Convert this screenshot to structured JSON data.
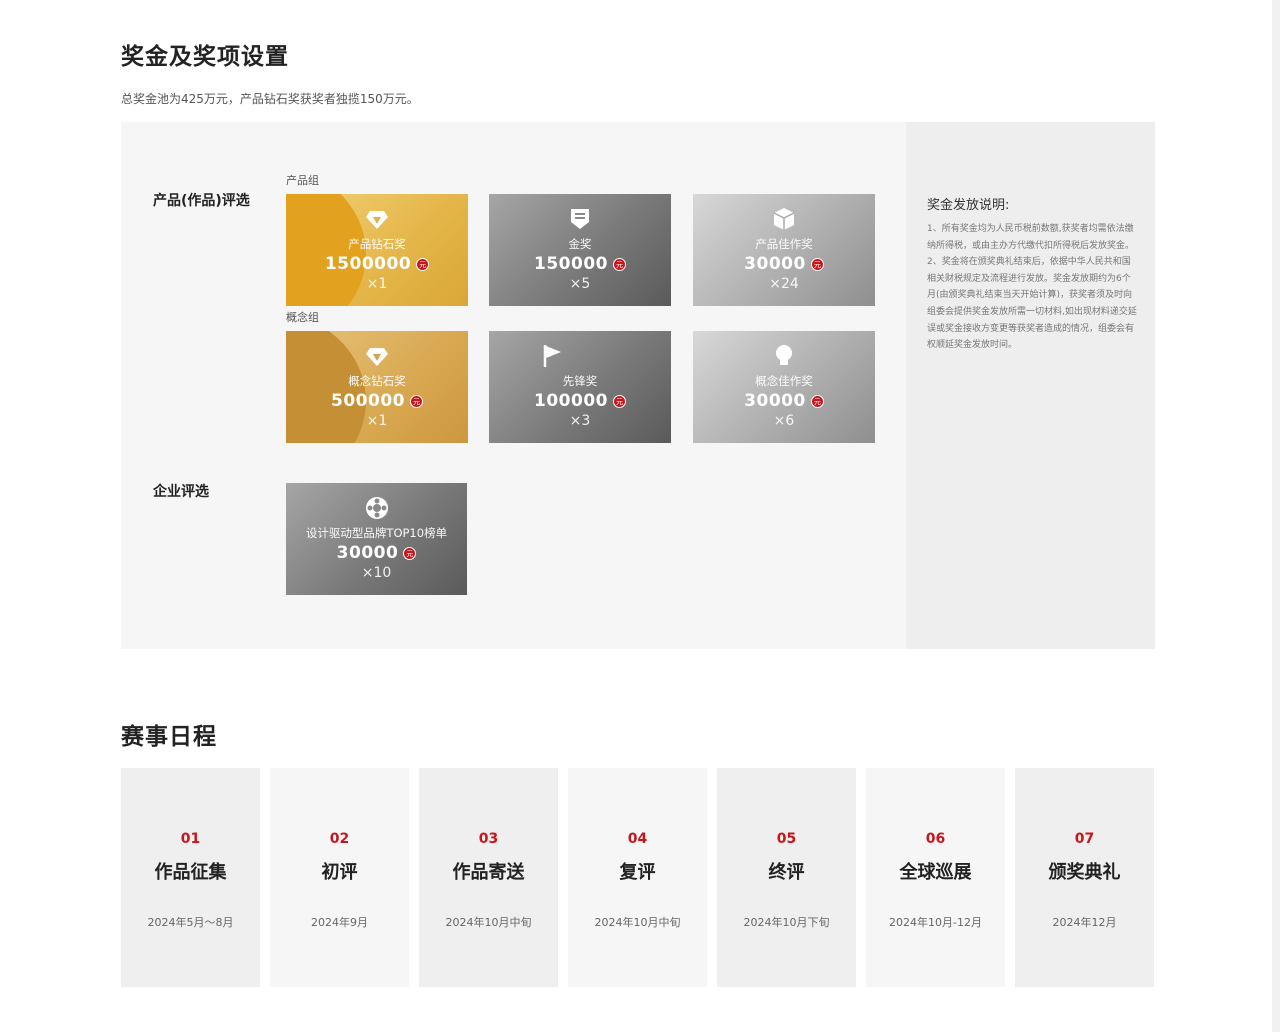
{
  "prize_section": {
    "title": "奖金及奖项设置",
    "subtitle": "总奖金池为425万元，产品钻石奖获奖者独揽150万元。",
    "product_label": "产品(作品)评选",
    "product_group": "产品组",
    "concept_group": "概念组",
    "enterprise_label": "企业评选",
    "yuan": "元",
    "cards": [
      {
        "name": "产品钻石奖",
        "amount": "1500000",
        "count": "×1",
        "style": "gold1",
        "icon": "diamond-icon"
      },
      {
        "name": "金奖",
        "amount": "150000",
        "count": "×5",
        "style": "dark",
        "icon": "badge-icon"
      },
      {
        "name": "产品佳作奖",
        "amount": "30000",
        "count": "×24",
        "style": "light",
        "icon": "cube-icon"
      },
      {
        "name": "概念钻石奖",
        "amount": "500000",
        "count": "×1",
        "style": "gold2",
        "icon": "diamond-icon"
      },
      {
        "name": "先锋奖",
        "amount": "100000",
        "count": "×3",
        "style": "dark",
        "icon": "flag-icon"
      },
      {
        "name": "概念佳作奖",
        "amount": "30000",
        "count": "×6",
        "style": "light",
        "icon": "bulb-icon"
      },
      {
        "name": "设计驱动型品牌TOP10榜单",
        "amount": "30000",
        "count": "×10",
        "style": "dark",
        "icon": "brand-icon"
      }
    ],
    "note_title": "奖金发放说明:",
    "note_body": "1、所有奖金均为人民币税前数额,获奖者均需依法缴纳所得税，或由主办方代缴代扣所得税后发放奖金。 2、奖金将在颁奖典礼结束后，依据中华人民共和国相关财税规定及流程进行发放。奖金发放期约为6个月(由颁奖典礼结束当天开始计算)，获奖者须及时向组委会提供奖金发放所需一切材料,如出现材料递交延误或奖金接收方变更等获奖者造成的情况，组委会有权顺延奖金发放时间。"
  },
  "schedule_section": {
    "title": "赛事日程",
    "steps": [
      {
        "no": "01",
        "name": "作品征集",
        "date": "2024年5月～8月"
      },
      {
        "no": "02",
        "name": "初评",
        "date": "2024年9月"
      },
      {
        "no": "03",
        "name": "作品寄送",
        "date": "2024年10月中旬"
      },
      {
        "no": "04",
        "name": "复评",
        "date": "2024年10月中旬"
      },
      {
        "no": "05",
        "name": "终评",
        "date": "2024年10月下旬"
      },
      {
        "no": "06",
        "name": "全球巡展",
        "date": "2024年10月-12月"
      },
      {
        "no": "07",
        "name": "颁奖典礼",
        "date": "2024年12月"
      }
    ]
  }
}
